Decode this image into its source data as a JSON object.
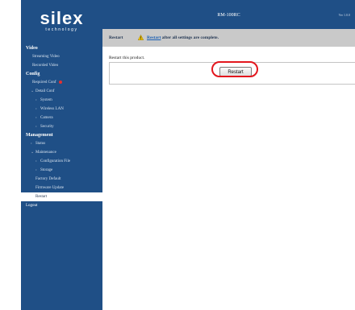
{
  "brand": {
    "wordmark": "silex",
    "tagline": "technology"
  },
  "header": {
    "model": "RM-100RC",
    "version": "Ver 1.0.0"
  },
  "sidebar": {
    "sections": [
      {
        "title": "Video",
        "items": [
          "Streaming Video",
          "Recorded Video"
        ]
      },
      {
        "title": "Config",
        "required_label": "Required Conf",
        "detail_label": "Detail Conf",
        "detail_items": [
          "System",
          "Wireless LAN",
          "Camera",
          "Security"
        ]
      },
      {
        "title": "Management",
        "status_label": "Status",
        "maintenance_label": "Maintenance",
        "maintenance_items": [
          "Configuration File",
          "Storage",
          "Factory Default",
          "Firmware Update",
          "Restart"
        ]
      }
    ],
    "logout_label": "Logout",
    "active_item": "Restart"
  },
  "page": {
    "title": "Restart",
    "notice_link": "Restart",
    "notice_text": "after all settings are complete.",
    "instruction": "Restart this product.",
    "restart_button": "Restart"
  },
  "colors": {
    "sidebar_bg": "#1f4f86",
    "header_gray": "#c9c9c9",
    "highlight": "#e3161d",
    "required_dot": "#e43030"
  }
}
